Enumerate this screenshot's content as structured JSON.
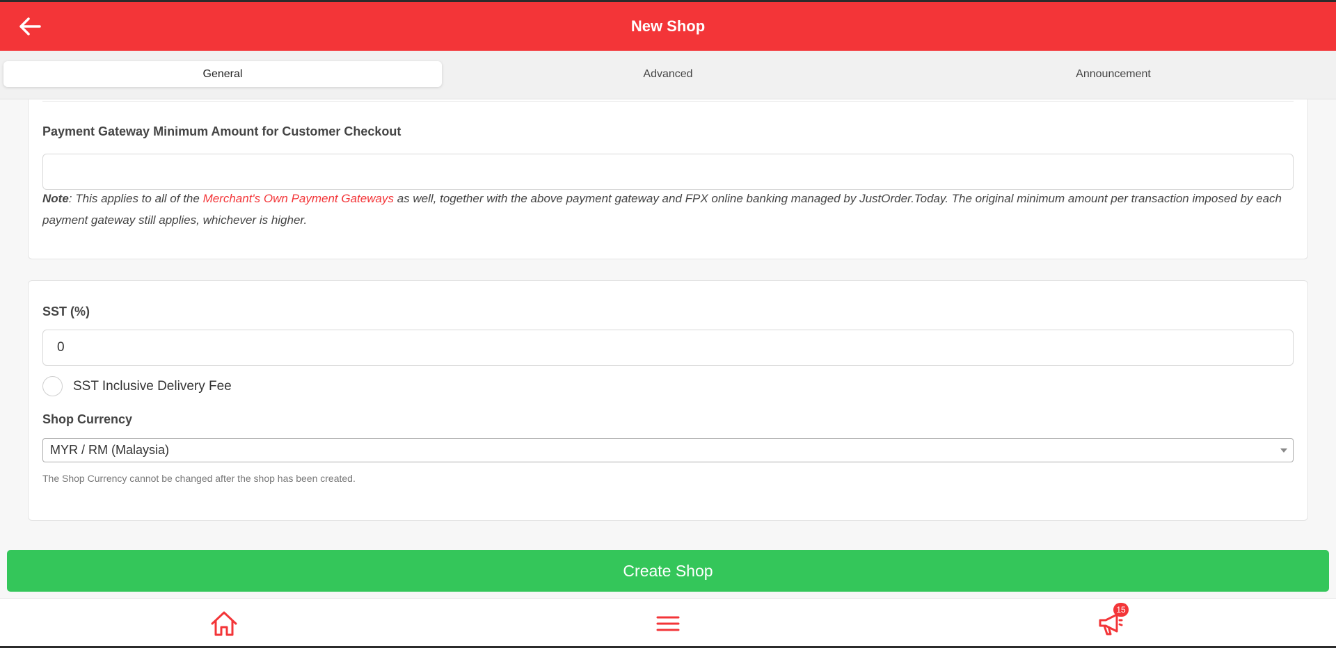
{
  "colors": {
    "brand_red": "#f33538",
    "create_green": "#34c65a"
  },
  "header": {
    "title": "New Shop",
    "back_icon": "arrow-left-icon"
  },
  "tabs": [
    {
      "label": "General",
      "active": true
    },
    {
      "label": "Advanced",
      "active": false
    },
    {
      "label": "Announcement",
      "active": false
    }
  ],
  "payment_section": {
    "label": "Payment Gateway Minimum Amount for Customer Checkout",
    "value": "",
    "note_prefix": "Note",
    "note_text_1": ": This applies to all of the ",
    "note_link": "Merchant's Own Payment Gateways",
    "note_text_2": " as well, together with the above payment gateway and FPX online banking managed by JustOrder.Today. The original minimum amount per transaction imposed by each payment gateway still applies, whichever is higher."
  },
  "sst_section": {
    "label": "SST (%)",
    "value": "0",
    "checkbox_label": "SST Inclusive Delivery Fee",
    "checkbox_checked": false,
    "currency_label": "Shop Currency",
    "currency_value": "MYR / RM (Malaysia)",
    "currency_help": "The Shop Currency cannot be changed after the shop has been created."
  },
  "actions": {
    "create_label": "Create Shop"
  },
  "bottom_nav": {
    "home_icon": "home-icon",
    "menu_icon": "hamburger-menu-icon",
    "announcement_icon": "megaphone-icon",
    "announcement_badge": "15"
  }
}
